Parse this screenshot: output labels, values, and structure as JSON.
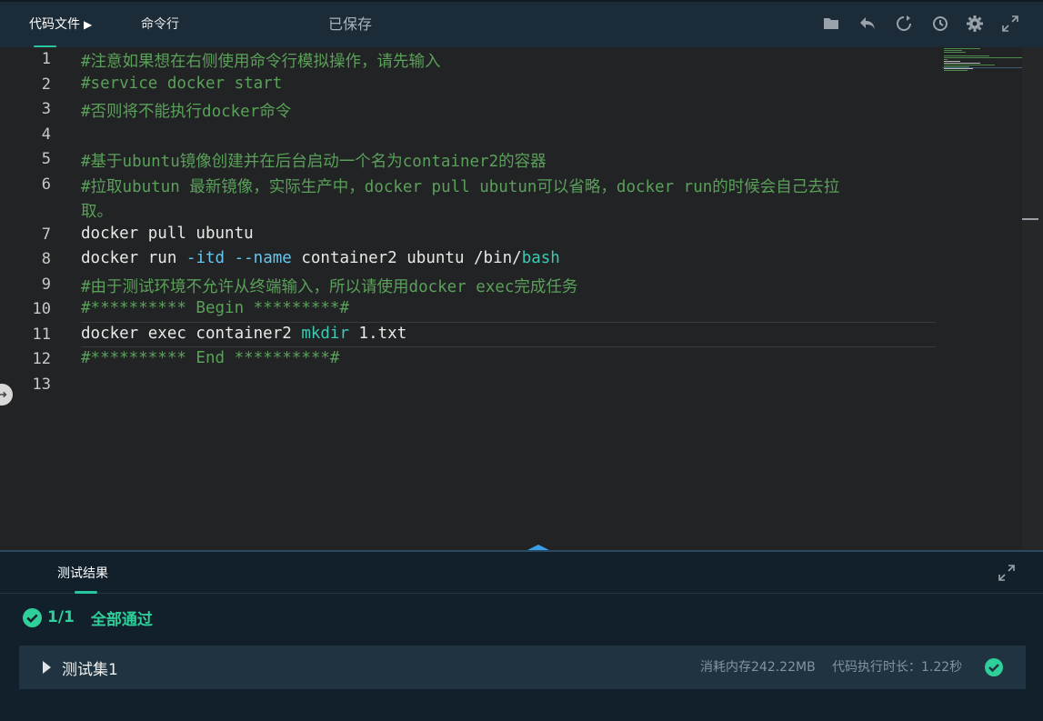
{
  "toolbar": {
    "tabs": [
      {
        "label": "代码文件",
        "arrow": "▶"
      },
      {
        "label": "命令行"
      }
    ],
    "status": "已保存",
    "icons": [
      "folder-icon",
      "undo-icon",
      "refresh-icon",
      "restore-icon",
      "gear-icon",
      "fullscreen-icon"
    ]
  },
  "editor": {
    "line_numbers": [
      "1",
      "2",
      "3",
      "4",
      "5",
      "6",
      "7",
      "8",
      "9",
      "10",
      "11",
      "12",
      "13"
    ],
    "lines": {
      "l1": "#注意如果想在右侧使用命令行模拟操作，请先输入",
      "l2": "#service docker start",
      "l3": "#否则将不能执行docker命令",
      "l5": "#基于ubuntu镜像创建并在后台启动一个名为container2的容器",
      "l6a": "#拉取ubutun 最新镜像，实际生产中，docker pull ubutun可以省略，docker run的时候会自己去拉",
      "l6b": "取。",
      "l7": "docker pull ubuntu",
      "l8_cmd": "docker run ",
      "l8_opt1": "-itd",
      "l8_sp1": " ",
      "l8_opt2": "--name",
      "l8_mid": " container2 ubuntu /bin/",
      "l8_kw": "bash",
      "l9": "#由于测试环境不允许从终端输入，所以请使用docker exec完成任务",
      "l10": "#********** Begin *********#",
      "l11_cmd": "docker exec container2 ",
      "l11_kw": "mkdir",
      "l11_rest": " 1.txt",
      "l12": "#********** End **********#"
    }
  },
  "results": {
    "tab_label": "测试结果",
    "pass_count": "1/1",
    "pass_text": "全部通过",
    "testset": {
      "name": "测试集1",
      "memory": "消耗内存242.22MB",
      "time": "代码执行时长：1.22秒"
    },
    "colors": {
      "accent": "#26c6a0",
      "pass": "#2fcf9a"
    }
  }
}
